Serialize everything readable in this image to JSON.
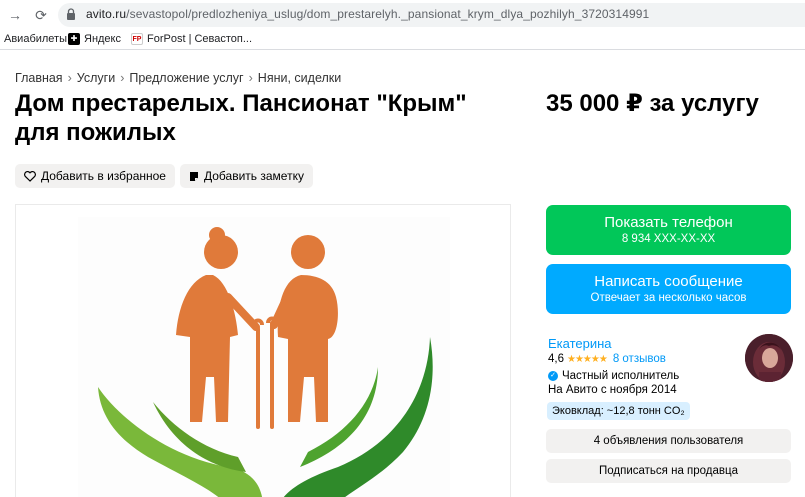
{
  "browser": {
    "url_host": "avito.ru",
    "url_path": "/sevastopol/predlozheniya_uslug/dom_prestarelyh._pansionat_krym_dlya_pozhilyh_3720314991",
    "bookmarks": [
      {
        "label": "Авиабилеты",
        "icon": "plane-icon"
      },
      {
        "label": "Яндекс",
        "icon": "yandex-icon"
      },
      {
        "label": "ForPost | Севастоп...",
        "icon": "forpost-icon"
      }
    ]
  },
  "breadcrumbs": [
    "Главная",
    "Услуги",
    "Предложение услуг",
    "Няни, сиделки"
  ],
  "listing": {
    "title_line1": "Дом престарелых. Пансионат \"Крым\"",
    "title_line2": "для пожилых",
    "price": "35 000 ₽ за услугу"
  },
  "actions": {
    "favorite": "Добавить в избранное",
    "note": "Добавить заметку"
  },
  "contact": {
    "show_phone": "Показать телефон",
    "phone_masked": "8 934 XXX-XX-XX",
    "write_message": "Написать сообщение",
    "reply_time": "Отвечает за несколько часов"
  },
  "seller": {
    "name": "Екатерина",
    "rating": "4,6",
    "stars": "★★★★★",
    "reviews": "8 отзывов",
    "type": "Частный исполнитель",
    "since": "На Авито с ноября 2014",
    "eco": "Эковклад: ~12,8 тонн CO₂",
    "listings_button": "4 объявления пользователя",
    "subscribe_button": "Подписаться на продавца"
  },
  "colors": {
    "green": "#01c759",
    "blue": "#00aaff",
    "link": "#0099f7",
    "logo_orange": "#e07a3a",
    "logo_green": "#2f8a2a"
  }
}
